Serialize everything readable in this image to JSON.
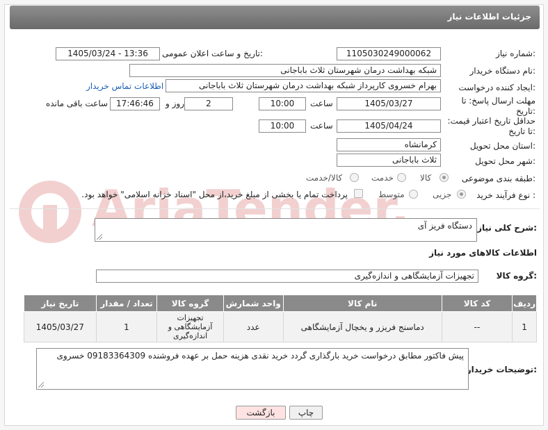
{
  "header": {
    "title": "جزئیات اطلاعات نیاز"
  },
  "fields": {
    "need_number_label": "شماره نیاز:",
    "need_number": "1105030249000062",
    "announce_label": "تاریخ و ساعت اعلان عمومی:",
    "announce_value": "1405/03/24 - 13:36",
    "buyer_org_label": "نام دستگاه خریدار:",
    "buyer_org": "شبکه بهداشت درمان شهرستان ثلاث باباجانی",
    "creator_label": "ایجاد کننده درخواست:",
    "creator": "بهرام خسروی کارپرداز شبکه بهداشت درمان شهرستان ثلاث باباجانی",
    "contact_link": "اطلاعات تماس خریدار",
    "deadline_label": "مهلت ارسال پاسخ: تا تاریخ:",
    "deadline_date": "1405/03/27",
    "time_label": "ساعت",
    "deadline_time": "10:00",
    "days_value": "2",
    "days_label": "روز و",
    "remaining_time": "17:46:46",
    "remaining_label": "ساعت باقی مانده",
    "validity_label": "حداقل تاریخ اعتبار قیمت: تا تاریخ:",
    "validity_date": "1405/04/24",
    "validity_time": "10:00",
    "province_label": "استان محل تحویل:",
    "province": "کرمانشاه",
    "city_label": "شهر محل تحویل:",
    "city": "ثلاث باباجانی",
    "category_label": "طبقه بندی موضوعی:",
    "category_options": [
      "کالا",
      "خدمت",
      "کالا/خدمت"
    ],
    "process_label": "نوع فرآیند خرید :",
    "process_options": [
      "جزیی",
      "متوسط"
    ],
    "payment_note": "پرداخت تمام یا بخشی از مبلغ خرید،از محل \"اسناد خزانه اسلامی\" خواهد بود."
  },
  "description": {
    "label": "شرح کلی نیاز:",
    "value": "دستگاه فریز آی"
  },
  "goods_section": {
    "title": "اطلاعات کالاهای مورد نیاز"
  },
  "goods_group": {
    "label": "گروه کالا:",
    "value": "تجهیزات آزمایشگاهی و اندازه‌گیری"
  },
  "table": {
    "headers": [
      "ردیف",
      "کد کالا",
      "نام کالا",
      "واحد شمارش",
      "گروه کالا",
      "تعداد / مقدار",
      "تاریخ نیاز"
    ],
    "rows": [
      [
        "1",
        "--",
        "دماسنج فریزر و یخچال آزمایشگاهی",
        "عدد",
        "تجهیزات آزمایشگاهی و اندازه‌گیری",
        "1",
        "1405/03/27"
      ]
    ]
  },
  "buyer_notes": {
    "label": "توضیحات خریدار:",
    "value": "پیش فاکتور مطابق درخواست خرید بارگذاری گردد خرید نقدی هزینه حمل بر عهده فروشنده 09183364309 خسروی"
  },
  "buttons": {
    "print": "چاپ",
    "back": "بازگشت"
  },
  "watermark": {
    "text": "AriaTender.net"
  },
  "colors": {
    "header": "#7a7a7a",
    "link": "#1a5fb4",
    "back_button_bg": "#ffe3e3",
    "print_button_bg": "#f0f0f0"
  }
}
